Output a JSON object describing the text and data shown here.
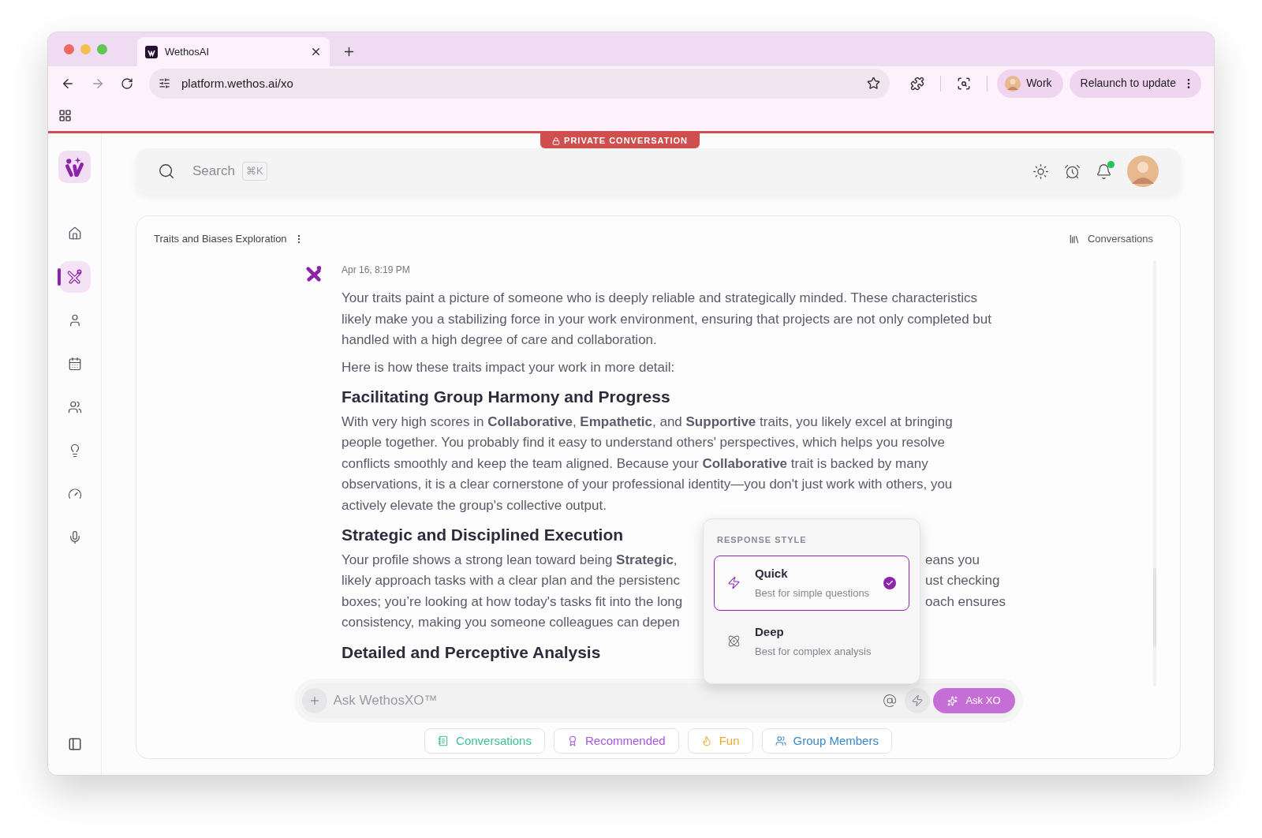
{
  "browser": {
    "tab": {
      "title": "WethosAI"
    },
    "url": "platform.wethos.ai/xo",
    "profile": "Work",
    "relaunch": "Relaunch to update"
  },
  "banner": "PRIVATE CONVERSATION",
  "sidebar": {
    "items": [
      {
        "kind": "home",
        "selected": false
      },
      {
        "kind": "xo",
        "selected": true
      },
      {
        "kind": "person",
        "selected": false
      },
      {
        "kind": "calendar",
        "selected": false
      },
      {
        "kind": "group",
        "selected": false
      },
      {
        "kind": "idea",
        "selected": false
      },
      {
        "kind": "gauge",
        "selected": false
      },
      {
        "kind": "mic",
        "selected": false
      }
    ]
  },
  "search": {
    "placeholder": "Search",
    "shortcut": "⌘K"
  },
  "header": {
    "notification_dot": true
  },
  "chat": {
    "title": "Traits and Biases Exploration",
    "conversations_label": "Conversations",
    "message": {
      "time": "Apr 16, 8:19 PM",
      "blocks": [
        {
          "kind": "paragraph",
          "text": "Your traits paint a picture of someone who is deeply reliable and strategically minded. These characteristics likely make you a stabilizing force in your work environment, ensuring that projects are not only completed but handled with a high degree of care and collaboration."
        },
        {
          "kind": "paragraph",
          "text": "Here is how these traits impact your work in more detail:"
        },
        {
          "kind": "heading",
          "text": "Facilitating Group Harmony and Progress"
        },
        {
          "kind": "paragraph",
          "text": "With very high scores in **Collaborative**, **Empathetic**, and **Supportive** traits, you likely excel at bringing people together. You probably find it easy to understand others' perspectives, which helps you resolve conflicts smoothly and keep the team aligned. Because your **Collaborative** trait is backed by many observations, it is a clear cornerstone of your professional identity—you don't just work with others, you actively elevate the group's collective output."
        },
        {
          "kind": "heading",
          "text": "Strategic and Disciplined Execution"
        },
        {
          "kind": "covered",
          "lines": [
            {
              "left": "Your profile shows a strong lean toward being **Strategic**,",
              "right": "eans you"
            },
            {
              "left": "likely approach tasks with a clear plan and the persistenc",
              "right": "ust checking"
            },
            {
              "left": "boxes; you’re looking at how today's tasks fit into the long",
              "right": "oach ensures"
            },
            {
              "left": "consistency, making you someone colleagues can depen"
            }
          ]
        },
        {
          "kind": "heading",
          "text": "Detailed and Perceptive Analysis"
        }
      ]
    }
  },
  "response_style": {
    "heading": "RESPONSE STYLE",
    "options": [
      {
        "kind": "quick",
        "label": "Quick",
        "description": "Best for simple questions",
        "selected": true
      },
      {
        "kind": "deep",
        "label": "Deep",
        "description": "Best for complex analysis",
        "selected": false
      }
    ]
  },
  "composer": {
    "placeholder": "Ask WethosXO™",
    "ask_button": "Ask XO"
  },
  "chips": [
    {
      "kind": "book",
      "label": "Conversations",
      "color": "#3dbf98"
    },
    {
      "kind": "award",
      "label": "Recommended",
      "color": "#a855e0"
    },
    {
      "kind": "flame",
      "label": "Fun",
      "color": "#f0a92a"
    },
    {
      "kind": "group",
      "label": "Group Members",
      "color": "#3a86c8"
    }
  ]
}
